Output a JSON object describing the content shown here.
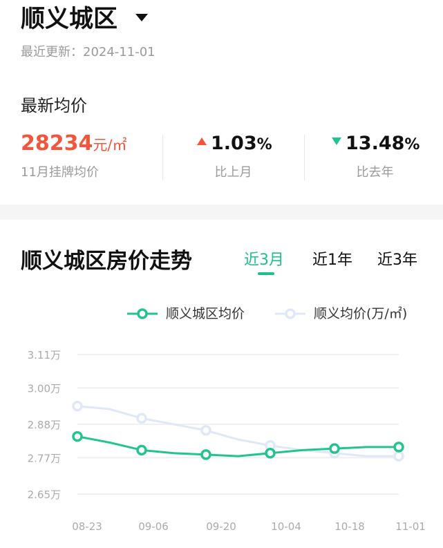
{
  "header": {
    "title": "顺义城区",
    "updated": "最近更新：2024-11-01"
  },
  "summary": {
    "section_label": "最新均价",
    "price_value": "28234",
    "price_unit": "元/㎡",
    "price_sub": "11月挂牌均价",
    "mom_value": "1.03",
    "mom_unit": "%",
    "mom_direction": "up",
    "mom_label": "比上月",
    "yoy_value": "13.48",
    "yoy_unit": "%",
    "yoy_direction": "down",
    "yoy_label": "比去年"
  },
  "trend": {
    "title": "顺义城区房价走势",
    "tabs": [
      "近3月",
      "近1年",
      "近3年"
    ],
    "active_tab": 0
  },
  "colors": {
    "accent_green": "#1fbf8a",
    "price_red": "#f2553c",
    "series_secondary": "#dfe8f7"
  },
  "chart_data": {
    "type": "line",
    "x": [
      "08-23",
      "08-30",
      "09-06",
      "09-13",
      "09-20",
      "09-27",
      "10-04",
      "10-11",
      "10-18",
      "10-25",
      "11-01"
    ],
    "x_tick_labels": [
      "08-23",
      "09-06",
      "09-20",
      "10-04",
      "10-18",
      "11-01"
    ],
    "y_tick_labels": [
      "3.11万",
      "3.00万",
      "2.88万",
      "2.77万",
      "2.65万"
    ],
    "y_ticks": [
      3.11,
      3.0,
      2.88,
      2.77,
      2.65
    ],
    "ylim": [
      2.65,
      3.11
    ],
    "grid": true,
    "legend_position": "top-right",
    "series": [
      {
        "name": "顺义城区均价",
        "color": "#22c48e",
        "values": [
          2.84,
          2.82,
          2.795,
          2.785,
          2.78,
          2.775,
          2.785,
          2.795,
          2.8,
          2.805,
          2.805
        ],
        "marker_every": 2
      },
      {
        "name": "顺义均价(万/㎡)",
        "color": "#dfe8f7",
        "values": [
          2.94,
          2.93,
          2.9,
          2.88,
          2.86,
          2.83,
          2.81,
          2.795,
          2.785,
          2.775,
          2.775
        ],
        "marker_every": 2
      }
    ]
  }
}
